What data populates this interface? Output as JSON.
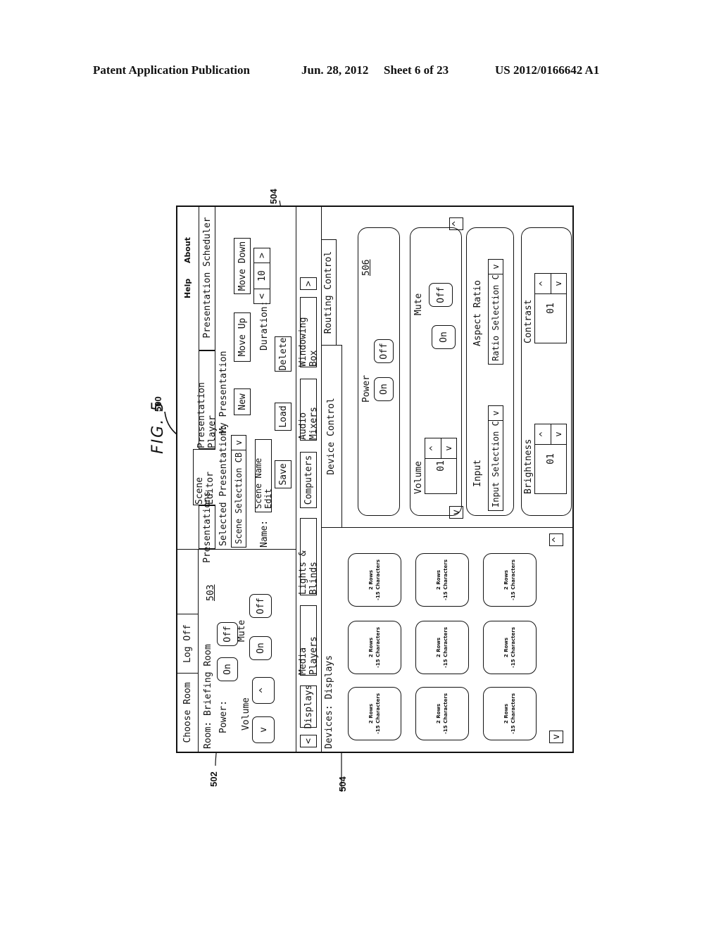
{
  "header": {
    "publication": "Patent Application Publication",
    "date": "Jun. 28, 2012",
    "sheet": "Sheet 6 of 23",
    "number": "US 2012/0166642 A1"
  },
  "figure": {
    "label": "FIG. 5"
  },
  "refs": {
    "r500": "500",
    "r502": "502",
    "r503": "503",
    "r504a": "504",
    "r504b": "504",
    "r506": "506"
  },
  "top_bar": {
    "choose_room": "Choose Room",
    "log_off": "Log Off",
    "help": "Help",
    "about": "About"
  },
  "tabs": [
    {
      "label": "Presentations",
      "active": false
    },
    {
      "label": "Scene Editor",
      "active": true
    },
    {
      "label": "Presentation Player",
      "active": false
    },
    {
      "label": "Presentation Scheduler",
      "active": false
    }
  ],
  "room_panel": {
    "room_label": "Room:",
    "room_name": "Briefing Room",
    "power_label": "Power:",
    "power_on": "On",
    "power_off": "Off",
    "volume_label": "Volume",
    "volume_down": "v",
    "volume_up": "^",
    "mute_label": "Mute",
    "mute_on": "On",
    "mute_off": "Off"
  },
  "scene_editor": {
    "selected_presentation_label": "Selected Presentation:",
    "selected_presentation_value": "My Presentation",
    "scene_select": "Scene Selection CB",
    "scene_select_arrow": "v",
    "new": "New",
    "move_up": "Move Up",
    "move_down": "Move Down",
    "name_label": "Name:",
    "name_value": "Scene Name Edit",
    "duration_label": "Duration:",
    "duration_dec": "<",
    "duration_value": "10",
    "duration_inc": ">",
    "save": "Save",
    "load": "Load",
    "delete": "Delete"
  },
  "device_categories": {
    "prev": "<",
    "next": ">",
    "items": [
      "Displays",
      "Media Players",
      "Lights & Blinds",
      "Computers",
      "Audio Mixers",
      "Windowing Box"
    ],
    "devices_label": "Devices:",
    "devices_value": "Displays"
  },
  "control_tabs": {
    "device_control": "Device Control",
    "routing_control": "Routing Control"
  },
  "tiles": {
    "line1": "2 Rows",
    "line2": "-15 Characters",
    "count": 9,
    "scroll_up": "^",
    "scroll_down": "v"
  },
  "device_control": {
    "scroll_up": "^",
    "scroll_down": "v",
    "power": {
      "label": "Power",
      "on": "On",
      "off": "Off"
    },
    "volume": {
      "label": "Volume",
      "value": "01",
      "up": "^",
      "down": "v"
    },
    "mute": {
      "label": "Mute",
      "on": "On",
      "off": "Off"
    },
    "input": {
      "label": "Input",
      "value": "Input Selection CB",
      "arrow": "v"
    },
    "aspect": {
      "label": "Aspect Ratio",
      "value": "Ratio Selection CB",
      "arrow": "v"
    },
    "brightness": {
      "label": "Brightness",
      "value": "01",
      "up": "^",
      "down": "v"
    },
    "contrast": {
      "label": "Contrast",
      "value": "01",
      "up": "^",
      "down": "v"
    }
  }
}
